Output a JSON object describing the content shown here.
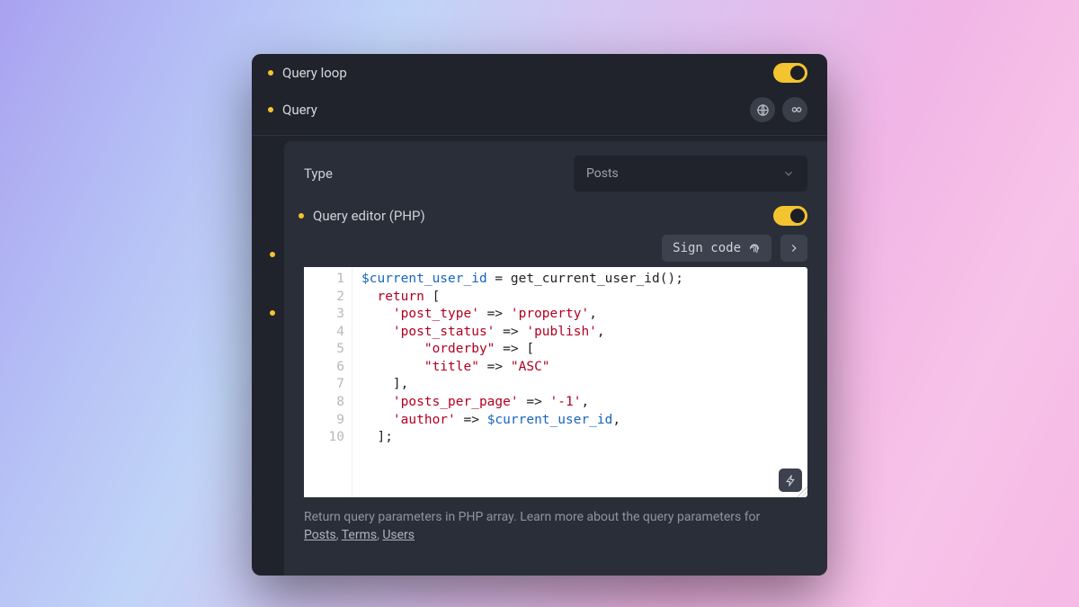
{
  "rows": {
    "query_loop": {
      "label": "Query loop",
      "toggled": true
    },
    "query": {
      "label": "Query"
    }
  },
  "outer_bullets": {
    "b1": true,
    "b2": true
  },
  "subpanel": {
    "type_label": "Type",
    "type_value": "Posts",
    "editor_label": "Query editor (PHP)",
    "editor_toggled": true,
    "sign_code_label": "Sign code",
    "line_numbers": [
      "1",
      "2",
      "3",
      "4",
      "5",
      "6",
      "7",
      "8",
      "9",
      "10"
    ],
    "code": {
      "l1_var": "$current_user_id",
      "l1_rest": " = get_current_user_id();",
      "l2_kw": "return",
      "l2_rest": " [",
      "l3_k": "'post_type'",
      "l3_v": "'property'",
      "l4_k": "'post_status'",
      "l4_v": "'publish'",
      "l5_k": "\"orderby\"",
      "l5_v": " [",
      "l6_k": "\"title\"",
      "l6_v": "\"ASC\"",
      "l7": "    ],",
      "l8_k": "'posts_per_page'",
      "l8_v": "'-1'",
      "l9_k": "'author'",
      "l9_var": "$current_user_id",
      "l10": "  ];"
    },
    "help_text": "Return query parameters in PHP array. Learn more about the query parameters for ",
    "help_links": {
      "posts": "Posts",
      "terms": "Terms",
      "users": "Users"
    }
  }
}
